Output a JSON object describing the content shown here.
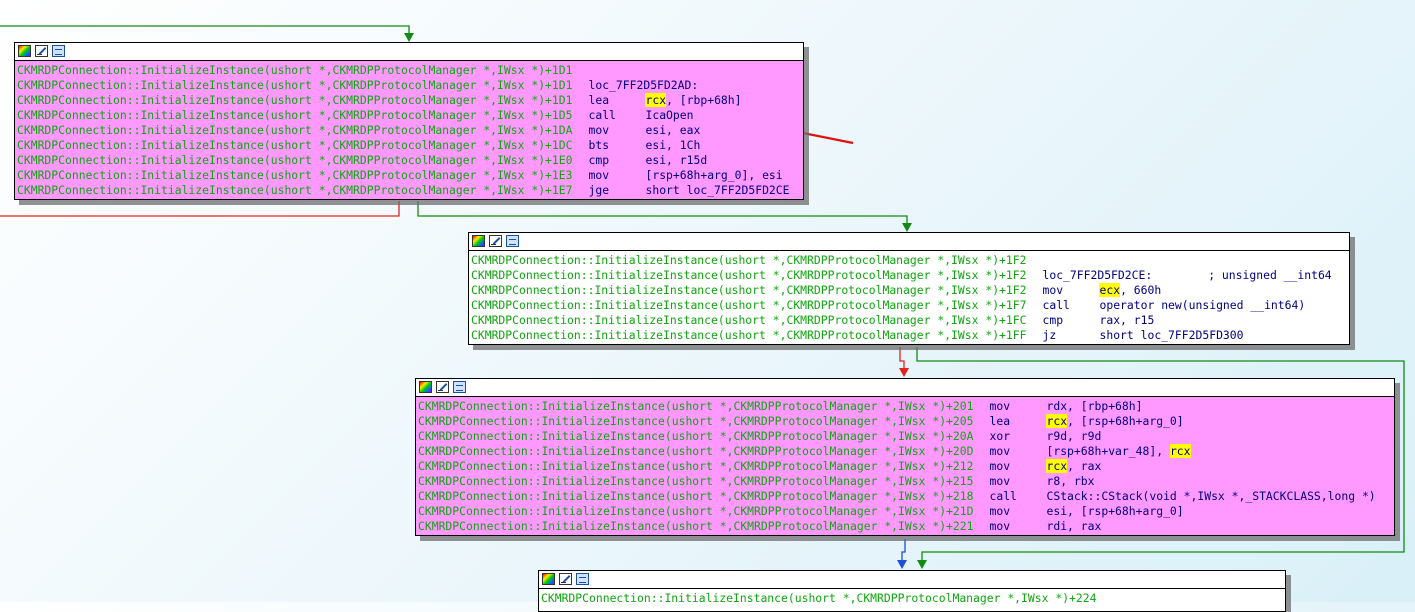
{
  "nodes": [
    {
      "id": "n1",
      "bg": "pink",
      "lines": [
        {
          "addr": "CKMRDPConnection::InitializeInstance(ushort *,CKMRDPProtocolManager *,IWsx *)+1D1",
          "label": ""
        },
        {
          "addr": "CKMRDPConnection::InitializeInstance(ushort *,CKMRDPProtocolManager *,IWsx *)+1D1",
          "label": "loc_7FF2D5FD2AD:"
        },
        {
          "addr": "CKMRDPConnection::InitializeInstance(ushort *,CKMRDPProtocolManager *,IWsx *)+1D1",
          "mn": "lea",
          "hl": "rcx",
          "rest": ", [rbp+68h]"
        },
        {
          "addr": "CKMRDPConnection::InitializeInstance(ushort *,CKMRDPProtocolManager *,IWsx *)+1D5",
          "mn": "call",
          "rest": "IcaOpen"
        },
        {
          "addr": "CKMRDPConnection::InitializeInstance(ushort *,CKMRDPProtocolManager *,IWsx *)+1DA",
          "mn": "mov",
          "rest": "esi, eax"
        },
        {
          "addr": "CKMRDPConnection::InitializeInstance(ushort *,CKMRDPProtocolManager *,IWsx *)+1DC",
          "mn": "bts",
          "rest": "esi, 1Ch"
        },
        {
          "addr": "CKMRDPConnection::InitializeInstance(ushort *,CKMRDPProtocolManager *,IWsx *)+1E0",
          "mn": "cmp",
          "rest": "esi, r15d"
        },
        {
          "addr": "CKMRDPConnection::InitializeInstance(ushort *,CKMRDPProtocolManager *,IWsx *)+1E3",
          "mn": "mov",
          "rest": "[rsp+68h+arg_0], esi"
        },
        {
          "addr": "CKMRDPConnection::InitializeInstance(ushort *,CKMRDPProtocolManager *,IWsx *)+1E7",
          "mn": "jge",
          "rest": "short loc_7FF2D5FD2CE"
        }
      ]
    },
    {
      "id": "n2",
      "bg": "white",
      "lines": [
        {
          "addr": "CKMRDPConnection::InitializeInstance(ushort *,CKMRDPProtocolManager *,IWsx *)+1F2",
          "label": ""
        },
        {
          "addr": "CKMRDPConnection::InitializeInstance(ushort *,CKMRDPProtocolManager *,IWsx *)+1F2",
          "label": "loc_7FF2D5FD2CE:",
          "comment": "; unsigned __int64"
        },
        {
          "addr": "CKMRDPConnection::InitializeInstance(ushort *,CKMRDPProtocolManager *,IWsx *)+1F2",
          "mn": "mov",
          "hl": "ecx",
          "rest": ", 660h"
        },
        {
          "addr": "CKMRDPConnection::InitializeInstance(ushort *,CKMRDPProtocolManager *,IWsx *)+1F7",
          "mn": "call",
          "rest": "operator new(unsigned __int64)"
        },
        {
          "addr": "CKMRDPConnection::InitializeInstance(ushort *,CKMRDPProtocolManager *,IWsx *)+1FC",
          "mn": "cmp",
          "rest": "rax, r15"
        },
        {
          "addr": "CKMRDPConnection::InitializeInstance(ushort *,CKMRDPProtocolManager *,IWsx *)+1FF",
          "mn": "jz",
          "rest": "short loc_7FF2D5FD300"
        }
      ]
    },
    {
      "id": "n3",
      "bg": "pink",
      "lines": [
        {
          "addr": "CKMRDPConnection::InitializeInstance(ushort *,CKMRDPProtocolManager *,IWsx *)+201",
          "mn": "mov",
          "rest": "rdx, [rbp+68h]"
        },
        {
          "addr": "CKMRDPConnection::InitializeInstance(ushort *,CKMRDPProtocolManager *,IWsx *)+205",
          "mn": "lea",
          "hl": "rcx",
          "rest": ", [rsp+68h+arg_0]"
        },
        {
          "addr": "CKMRDPConnection::InitializeInstance(ushort *,CKMRDPProtocolManager *,IWsx *)+20A",
          "mn": "xor",
          "rest": "r9d, r9d"
        },
        {
          "addr": "CKMRDPConnection::InitializeInstance(ushort *,CKMRDPProtocolManager *,IWsx *)+20D",
          "mn": "mov",
          "rest": "[rsp+68h+var_48], ",
          "hl2": "rcx"
        },
        {
          "addr": "CKMRDPConnection::InitializeInstance(ushort *,CKMRDPProtocolManager *,IWsx *)+212",
          "mn": "mov",
          "hl": "rcx",
          "rest": ", rax"
        },
        {
          "addr": "CKMRDPConnection::InitializeInstance(ushort *,CKMRDPProtocolManager *,IWsx *)+215",
          "mn": "mov",
          "rest": "r8, rbx"
        },
        {
          "addr": "CKMRDPConnection::InitializeInstance(ushort *,CKMRDPProtocolManager *,IWsx *)+218",
          "mn": "call",
          "rest": "CStack::CStack(void *,IWsx *,_STACKCLASS,long *)"
        },
        {
          "addr": "CKMRDPConnection::InitializeInstance(ushort *,CKMRDPProtocolManager *,IWsx *)+21D",
          "mn": "mov",
          "rest": "esi, [rsp+68h+arg_0]"
        },
        {
          "addr": "CKMRDPConnection::InitializeInstance(ushort *,CKMRDPProtocolManager *,IWsx *)+221",
          "mn": "mov",
          "rest": "rdi, rax"
        }
      ]
    },
    {
      "id": "n4",
      "bg": "white",
      "lines": [
        {
          "addr": "CKMRDPConnection::InitializeInstance(ushort *,CKMRDPProtocolManager *,IWsx *)+224",
          "label": ""
        }
      ]
    }
  ],
  "colors": {
    "addr": "#11a511",
    "mnemonic": "#000080",
    "highlight": "#ffff00",
    "pink_block": "#ff99ff",
    "edge_true": "#138a13",
    "edge_false": "#e32222",
    "edge_uncond": "#1f4fd6",
    "annotation_arrow": "#e01010"
  }
}
